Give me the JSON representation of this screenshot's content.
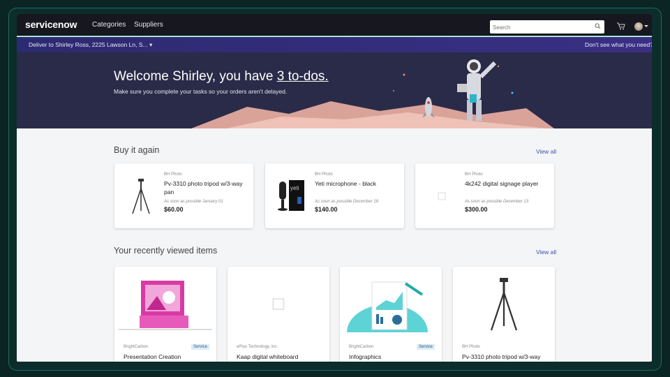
{
  "header": {
    "logo": "servicenow",
    "nav": [
      "Categories",
      "Suppliers"
    ],
    "search_placeholder": "Search"
  },
  "subbar": {
    "deliver": "Deliver to Shirley Ross, 2225 Lawson Ln, S...",
    "help": "Don't see what you need?"
  },
  "hero": {
    "title_prefix": "Welcome Shirley, you have ",
    "title_link": "3 to-dos.",
    "subtitle": "Make sure you complete your tasks so your orders aren't delayed."
  },
  "buy_again": {
    "title": "Buy it again",
    "view_all": "View all",
    "items": [
      {
        "vendor": "BH Photo",
        "name": "Pv-3310 photo tripod w/3-way pan",
        "eta": "As soon as possible January 01",
        "price": "$60.00",
        "image": "tripod"
      },
      {
        "vendor": "BH Photo",
        "name": "Yeti microphone - black",
        "eta": "As soon as possible December 18",
        "price": "$140.00",
        "image": "microphone"
      },
      {
        "vendor": "BH Photo",
        "name": "4k242 digital signage player",
        "eta": "As soon as possible December 13",
        "price": "$300.00",
        "image": "placeholder"
      }
    ]
  },
  "recent": {
    "title": "Your recently viewed items",
    "view_all": "View all",
    "items": [
      {
        "vendor": "BrightCarbon",
        "badge": "Service",
        "name": "Presentation Creation",
        "image": "presentation"
      },
      {
        "vendor": "ePlus Technology, inc.",
        "badge": "",
        "name": "Kaap digital whiteboard",
        "image": "placeholder"
      },
      {
        "vendor": "BrightCarbon",
        "badge": "Service",
        "name": "Infographics",
        "image": "infographic"
      },
      {
        "vendor": "BH Photo",
        "badge": "",
        "name": "Pv-3310 photo tripod w/3-way",
        "image": "tripod"
      }
    ]
  }
}
